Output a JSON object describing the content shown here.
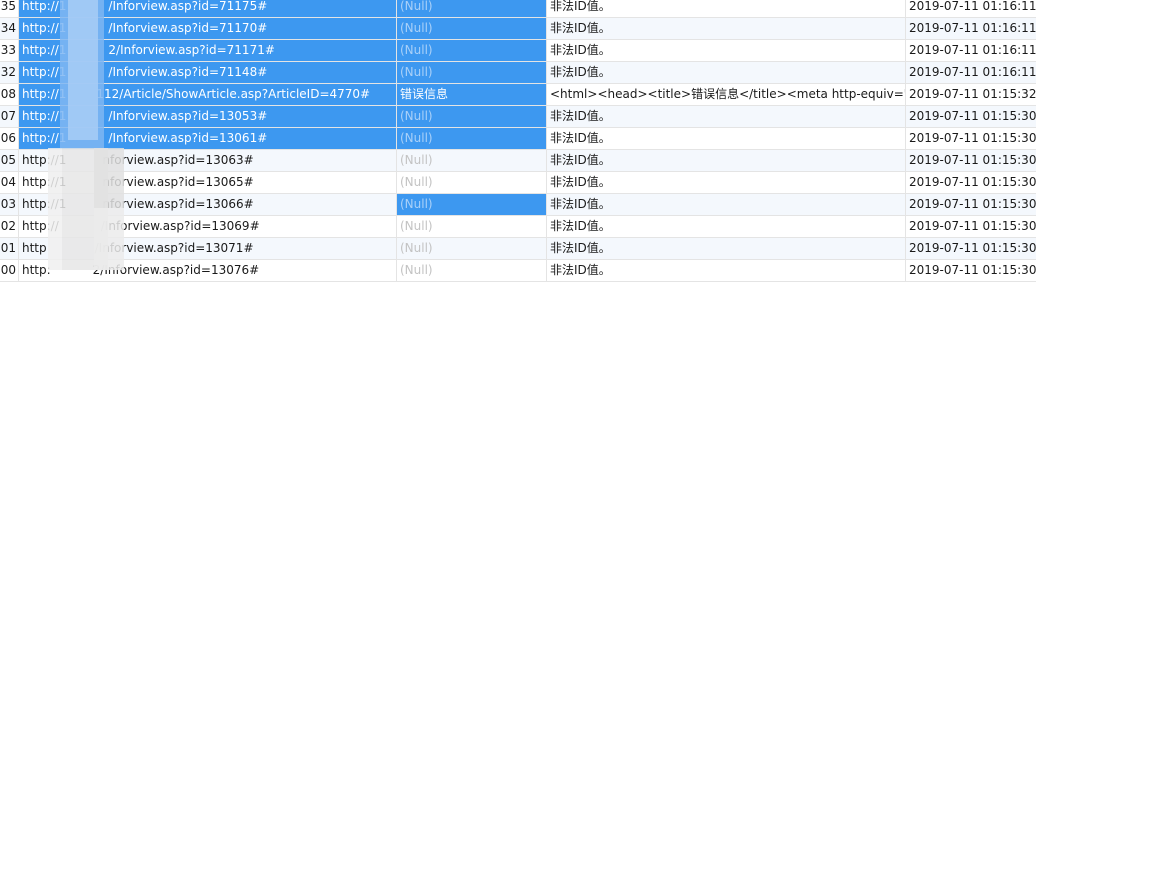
{
  "rows": [
    {
      "id": "35",
      "url": "http://1       /Inforview.asp?id=71175#",
      "msg": "(Null)",
      "body": "非法ID值。",
      "time": "2019-07-11 01:16:11",
      "url_sel": true,
      "msg_sel": true,
      "partial": true
    },
    {
      "id": "34",
      "url": "http://1       /Inforview.asp?id=71170#",
      "msg": "(Null)",
      "body": "非法ID值。",
      "time": "2019-07-11 01:16:11",
      "url_sel": true,
      "msg_sel": true
    },
    {
      "id": "33",
      "url": "http://1       2/Inforview.asp?id=71171#",
      "msg": "(Null)",
      "body": "非法ID值。",
      "time": "2019-07-11 01:16:11",
      "url_sel": true,
      "msg_sel": true
    },
    {
      "id": "32",
      "url": "http://1       /Inforview.asp?id=71148#",
      "msg": "(Null)",
      "body": "非法ID值。",
      "time": "2019-07-11 01:16:11",
      "url_sel": true,
      "msg_sel": true
    },
    {
      "id": "08",
      "url": "http://1     112/Article/ShowArticle.asp?ArticleID=4770#",
      "msg": "错误信息",
      "body": "<html><head><title>错误信息</title><meta http-equiv='Cor",
      "time": "2019-07-11 01:15:32",
      "url_sel": true,
      "msg_sel": true,
      "msg_text": true
    },
    {
      "id": "07",
      "url": "http://1       /Inforview.asp?id=13053#",
      "msg": "(Null)",
      "body": "非法ID值。",
      "time": "2019-07-11 01:15:30",
      "url_sel": true,
      "msg_sel": true
    },
    {
      "id": "06",
      "url": "http://1       /Inforview.asp?id=13061#",
      "msg": "(Null)",
      "body": "非法ID值。",
      "time": "2019-07-11 01:15:30",
      "url_sel": true,
      "msg_sel": true
    },
    {
      "id": "05",
      "url": "http://1      nforview.asp?id=13063#",
      "msg": "(Null)",
      "body": "非法ID值。",
      "time": "2019-07-11 01:15:30",
      "url_sel": false,
      "msg_sel": false
    },
    {
      "id": "04",
      "url": "http://1      nforview.asp?id=13065#",
      "msg": "(Null)",
      "body": "非法ID值。",
      "time": "2019-07-11 01:15:30",
      "url_sel": false,
      "msg_sel": false
    },
    {
      "id": "03",
      "url": "http://1      nforview.asp?id=13066#",
      "msg": "(Null)",
      "body": "非法ID值。",
      "time": "2019-07-11 01:15:30",
      "url_sel": false,
      "msg_sel": true
    },
    {
      "id": "02",
      "url": "http://       /Inforview.asp?id=13069#",
      "msg": "(Null)",
      "body": "非法ID值。",
      "time": "2019-07-11 01:15:30",
      "url_sel": false,
      "msg_sel": false
    },
    {
      "id": "01",
      "url": "http        /Inforview.asp?id=13071#",
      "msg": "(Null)",
      "body": "非法ID值。",
      "time": "2019-07-11 01:15:30",
      "url_sel": false,
      "msg_sel": false
    },
    {
      "id": "00",
      "url": "http:       2/Inforview.asp?id=13076#",
      "msg": "(Null)",
      "body": "非法ID值。",
      "time": "2019-07-11 01:15:30",
      "url_sel": false,
      "msg_sel": false
    }
  ],
  "colors": {
    "selection": "#3d98f0",
    "null_text": "#c3c3c3",
    "grid_line": "#e4e4e4",
    "alt_row": "#f4f8fd"
  }
}
